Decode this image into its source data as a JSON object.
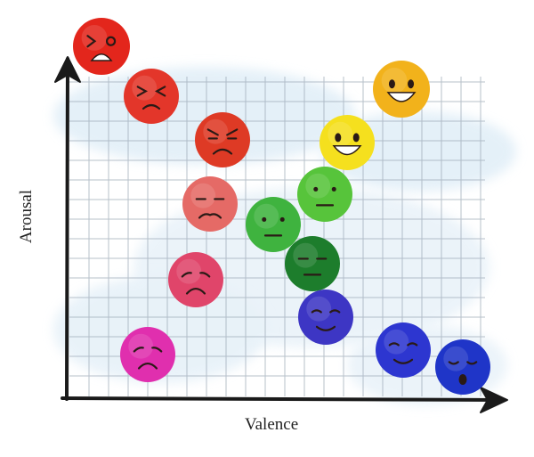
{
  "axes": {
    "x_label": "Valence",
    "y_label": "Arousal"
  },
  "faces": [
    {
      "name": "face-angry-shout",
      "color": "#e3261c",
      "expression": "shout"
    },
    {
      "name": "face-squint-frown",
      "color": "#e3362a",
      "expression": "squint-frown"
    },
    {
      "name": "face-angry",
      "color": "#de3a25",
      "expression": "angry"
    },
    {
      "name": "face-worried",
      "color": "#e56a66",
      "expression": "worried"
    },
    {
      "name": "face-sad",
      "color": "#e0456a",
      "expression": "sad"
    },
    {
      "name": "face-very-sad",
      "color": "#e02fae",
      "expression": "sad"
    },
    {
      "name": "face-big-smile",
      "color": "#f2b21b",
      "expression": "big-smile"
    },
    {
      "name": "face-smile",
      "color": "#f5e01e",
      "expression": "big-smile"
    },
    {
      "name": "face-light-neutral",
      "color": "#57c43b",
      "expression": "neutral"
    },
    {
      "name": "face-neutral",
      "color": "#3fb33f",
      "expression": "neutral"
    },
    {
      "name": "face-dark-neutral",
      "color": "#1d7d2c",
      "expression": "neutral-squint"
    },
    {
      "name": "face-calm",
      "color": "#3d36c4",
      "expression": "calm"
    },
    {
      "name": "face-relaxed",
      "color": "#2d36d0",
      "expression": "calm"
    },
    {
      "name": "face-sleepy",
      "color": "#1f35c8",
      "expression": "sleepy"
    }
  ]
}
